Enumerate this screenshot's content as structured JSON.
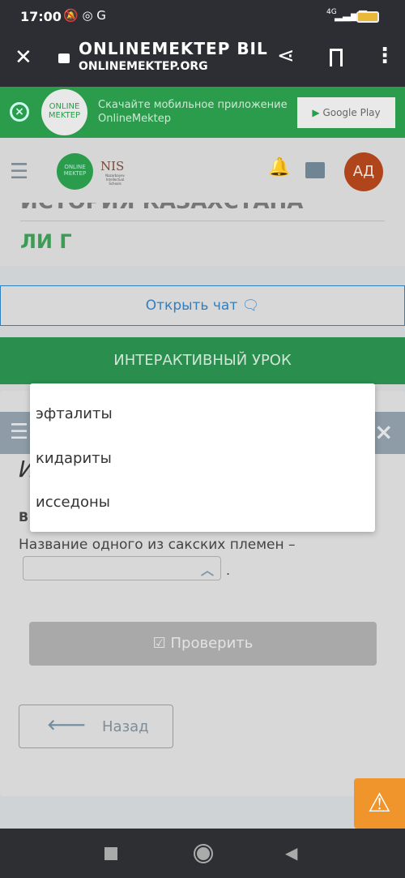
{
  "status_bar": {
    "time": "17:00",
    "network": "4G"
  },
  "browser": {
    "title": "ONLINEMEKTEP BIL",
    "url": "ONLINEMEKTEP.ORG"
  },
  "banner": {
    "logo": "ONLINE MEKTEP",
    "line1": "Скачайте мобильное приложение",
    "line2": "OnlineMektep",
    "store_button": "Google Play"
  },
  "header": {
    "logo": "ONLINE MEKTEP",
    "nis_logo": "NIS",
    "nis_sub": "Nazarbayev Intellectual Schools",
    "avatar": "АД"
  },
  "course": {
    "title": "ИСТОРИЯ КАЗАХСТАНА",
    "subtitle": "ЛИ Г"
  },
  "chat_button": "Открыть чат",
  "lesson_bar": "ИНТЕРАКТИВНЫЙ УРОК",
  "task": {
    "heading_fragment": "И",
    "label_fragment": "В",
    "sentence": "Название одного из сакских племен –",
    "select_value": "",
    "trailing": "."
  },
  "dropdown": {
    "options": [
      "эфталиты",
      "кидариты",
      "исседоны"
    ]
  },
  "check_button": "Проверить",
  "back_button": "Назад",
  "colors": {
    "green": "#2a9c4b",
    "accent_blue": "#2f7fc1",
    "warning": "#f0952c",
    "avatar": "#b0441a"
  }
}
